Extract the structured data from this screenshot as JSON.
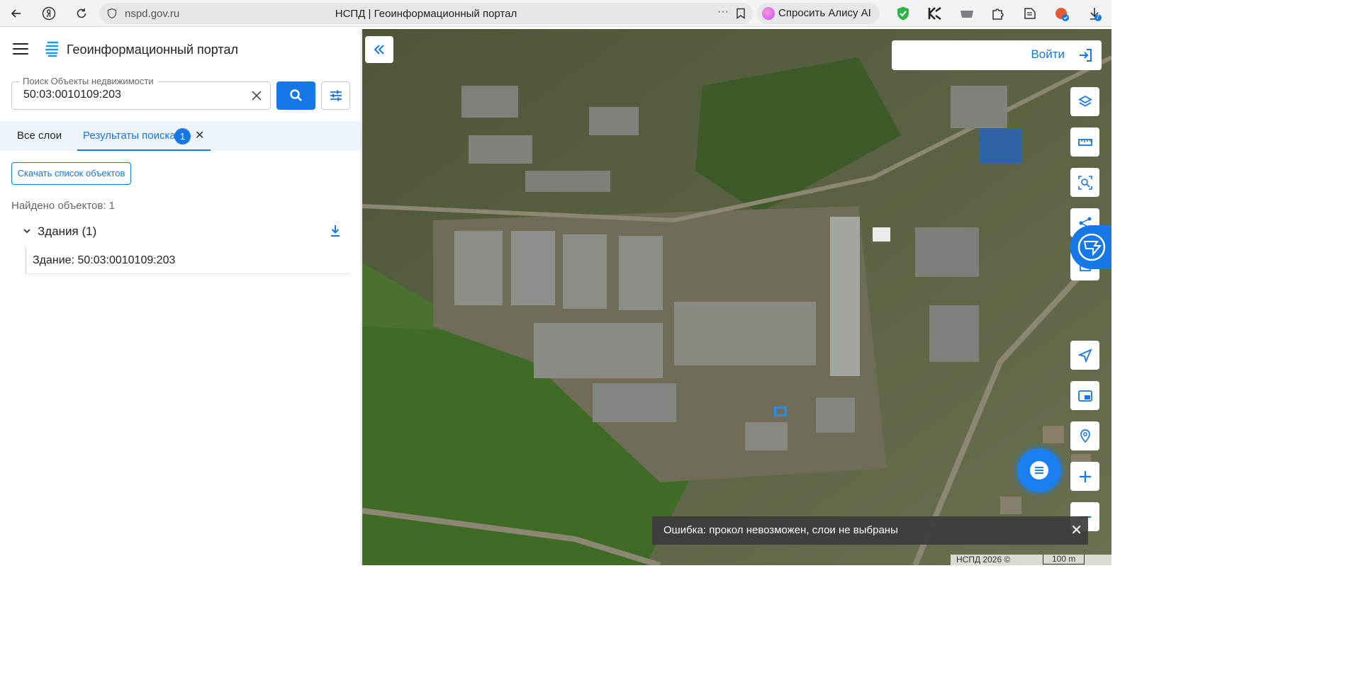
{
  "browser": {
    "url": "nspd.gov.ru",
    "tab_title": "НСПД | Геоинформационный портал",
    "alice_label": "Спросить Алису AI",
    "downloads_badge": "7"
  },
  "sidebar": {
    "portal_title": "Геоинформационный портал",
    "search": {
      "label": "Поиск Объекты недвижимости",
      "value": "50:03:0010109:203"
    },
    "tabs": [
      {
        "label": "Все слои"
      },
      {
        "label": "Результаты поиска",
        "badge": "1"
      }
    ],
    "download_list_label": "Скачать список объектов",
    "found_text": "Найдено объектов: 1",
    "group": {
      "label": "Здания (1)",
      "items": [
        {
          "label": "Здание: 50:03:0010109:203"
        }
      ]
    }
  },
  "map": {
    "login_label": "Войти",
    "toast": "Ошибка: прокол невозможен, слои не выбраны",
    "copyright": "НСПД 2026 ©",
    "scale_label": "100 m"
  },
  "colors": {
    "accent": "#1677e6",
    "tab_bg": "#eef4fb"
  }
}
